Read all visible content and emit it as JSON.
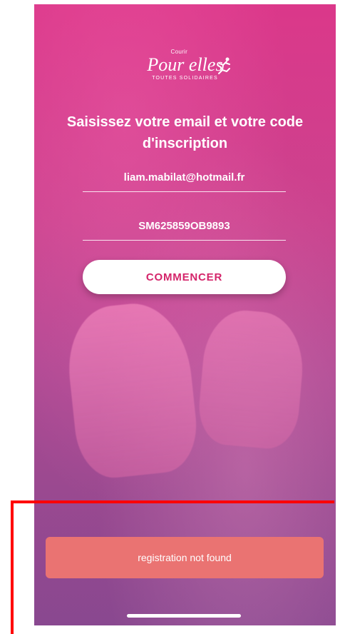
{
  "logo": {
    "top_small": "Courir",
    "main": "Pour elles",
    "tagline": "TOUTES SOLIDAIRES"
  },
  "title": "Saisissez votre email et votre code d'inscription",
  "form": {
    "email_value": "liam.mabilat@hotmail.fr",
    "code_value": "SM625859OB9893",
    "start_button_label": "COMMENCER"
  },
  "toast": {
    "message": "registration not found"
  },
  "colors": {
    "accent": "#d4246a",
    "toast_background": "#ea7372"
  }
}
